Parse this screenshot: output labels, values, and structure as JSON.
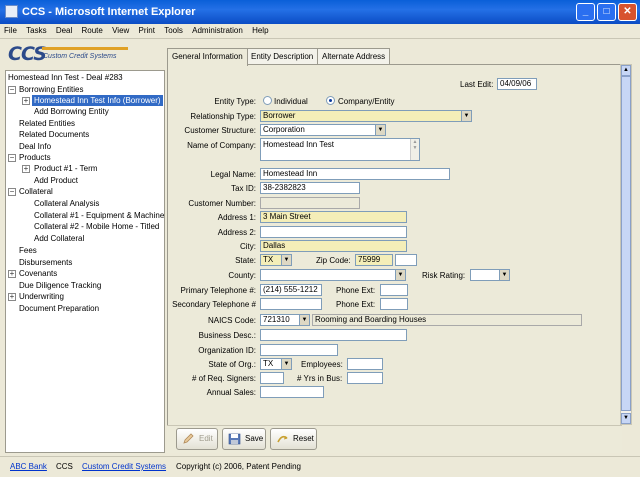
{
  "window": {
    "title": "CCS - Microsoft Internet Explorer"
  },
  "menu": [
    "File",
    "Tasks",
    "Deal",
    "Route",
    "View",
    "Print",
    "Tools",
    "Administration",
    "Help"
  ],
  "logo": {
    "text": "Custom Credit Systems"
  },
  "tree": {
    "root": "Homestead Inn Test - Deal #283",
    "items": [
      "Borrowing Entities",
      "Homestead Inn Test Info (Borrower)",
      "Add Borrowing Entity",
      "Related Entities",
      "Related Documents",
      "Deal Info",
      "Products",
      "Product #1 - Term",
      "Add Product",
      "Collateral",
      "Collateral Analysis",
      "Collateral #1 - Equipment & Machinery",
      "Collateral #2 - Mobile Home - Titled",
      "Add Collateral",
      "Fees",
      "Disbursements",
      "Covenants",
      "Due Diligence Tracking",
      "Underwriting",
      "Document Preparation"
    ]
  },
  "tabs": [
    "General Information",
    "Entity Description",
    "Alternate Address"
  ],
  "form": {
    "last_edit_label": "Last Edit:",
    "last_edit": "04/09/06",
    "entity_type_label": "Entity Type:",
    "entity_type_opt1": "Individual",
    "entity_type_opt2": "Company/Entity",
    "relationship_label": "Relationship Type:",
    "relationship": "Borrower",
    "structure_label": "Customer Structure:",
    "structure": "Corporation",
    "company_label": "Name of Company:",
    "company": "Homestead Inn Test",
    "legal_label": "Legal Name:",
    "legal": "Homestead Inn",
    "taxid_label": "Tax ID:",
    "taxid": "38-2382823",
    "custnum_label": "Customer Number:",
    "addr1_label": "Address 1:",
    "addr1": "3 Main Street",
    "addr2_label": "Address 2:",
    "city_label": "City:",
    "city": "Dallas",
    "state_label": "State:",
    "state": "TX",
    "zip_label": "Zip Code:",
    "zip": "75999",
    "county_label": "County:",
    "risk_label": "Risk Rating:",
    "phone1_label": "Primary Telephone #:",
    "phone1": "(214) 555-1212",
    "phoneext_label": "Phone Ext:",
    "phone2_label": "Secondary Telephone #",
    "phoneext2_label": "Phone Ext:",
    "naics_label": "NAICS Code:",
    "naics": "721310",
    "naics_desc": "Rooming and Boarding Houses",
    "bizdesc_label": "Business Desc.:",
    "orgid_label": "Organization ID:",
    "stateorg_label": "State of Org.:",
    "stateorg": "TX",
    "employees_label": "Employees:",
    "signers_label": "# of Req. Signers:",
    "yrs_label": "# Yrs in Bus:",
    "sales_label": "Annual Sales:"
  },
  "buttons": {
    "edit": "Edit",
    "save": "Save",
    "reset": "Reset"
  },
  "status": {
    "bank": "ABC Bank",
    "ccs": "CCS",
    "company": "Custom Credit Systems",
    "copyright": "Copyright (c) 2006, Patent Pending"
  }
}
